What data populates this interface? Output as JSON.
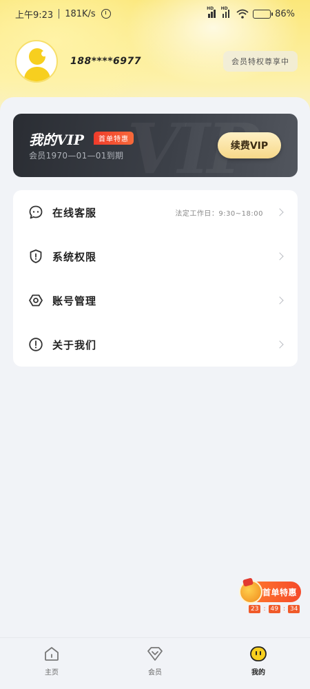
{
  "status_bar": {
    "time": "上午9:23",
    "speed": "181K/s",
    "battery": "86%",
    "hd_label": "HD"
  },
  "profile": {
    "phone": "188****6977",
    "member_privilege": "会员特权尊享中"
  },
  "vip_card": {
    "title": "我的VIP",
    "watermark": "VIP",
    "promo_badge": "首单特惠",
    "expire_text": "会员1970—01—01到期",
    "renew_label": "续费VIP"
  },
  "menu": {
    "items": [
      {
        "label": "在线客服",
        "note": "法定工作日：9:30~18:00",
        "icon": "chat-bubble-icon"
      },
      {
        "label": "系统权限",
        "note": "",
        "icon": "shield-icon"
      },
      {
        "label": "账号管理",
        "note": "",
        "icon": "hexagon-settings-icon"
      },
      {
        "label": "关于我们",
        "note": "",
        "icon": "info-icon"
      }
    ]
  },
  "float_promo": {
    "label": "首单特惠",
    "countdown": [
      "23",
      "49",
      "34"
    ],
    "separator": ":"
  },
  "bottom_nav": {
    "items": [
      {
        "label": "主页",
        "icon": "home-icon",
        "active": false
      },
      {
        "label": "会员",
        "icon": "diamond-icon",
        "active": false
      },
      {
        "label": "我的",
        "icon": "face-icon",
        "active": true
      }
    ]
  },
  "colors": {
    "accent_yellow": "#f7cf1f",
    "vip_dark": "#2a2d33",
    "promo_red": "#ef3b2b",
    "renew_gold": "#f7d88a"
  }
}
